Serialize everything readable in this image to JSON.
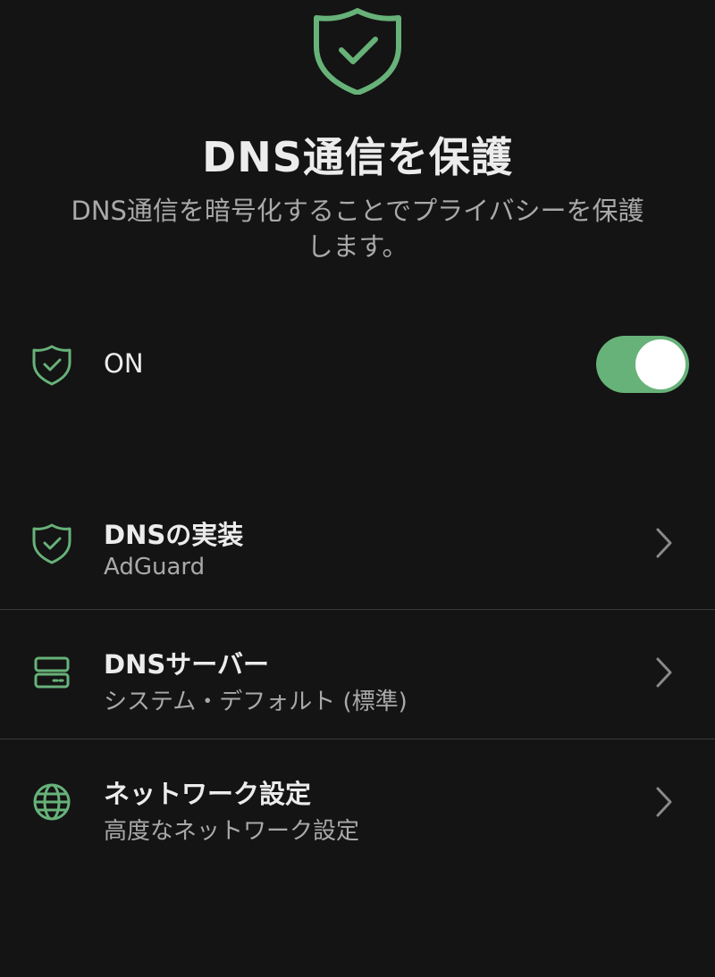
{
  "colors": {
    "background": "#141414",
    "accent": "#67b279",
    "text_primary": "#ececec",
    "text_secondary": "#a9a9a9",
    "divider": "#3a3a3a"
  },
  "header": {
    "icon": "shield-check-icon",
    "title": "DNS通信を保護",
    "subtitle_line1": "DNS通信を暗号化することでプライバシーを保護",
    "subtitle_line2": "します。"
  },
  "toggle": {
    "icon": "shield-check-icon",
    "label": "ON",
    "state": true
  },
  "settings": [
    {
      "icon": "shield-check-icon",
      "title": "DNSの実装",
      "subtitle": "AdGuard"
    },
    {
      "icon": "server-icon",
      "title": "DNSサーバー",
      "subtitle": "システム・デフォルト (標準)"
    },
    {
      "icon": "globe-icon",
      "title": "ネットワーク設定",
      "subtitle": "高度なネットワーク設定"
    }
  ]
}
